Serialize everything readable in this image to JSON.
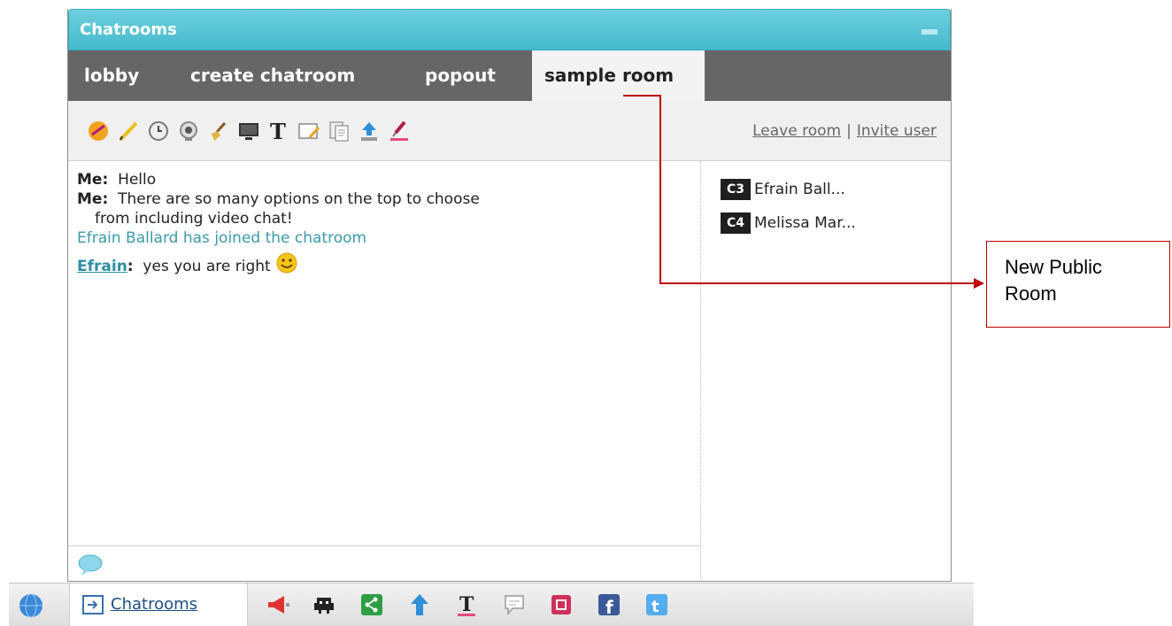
{
  "window": {
    "title": "Chatrooms"
  },
  "tabs": [
    {
      "label": "lobby"
    },
    {
      "label": "create chatroom"
    },
    {
      "label": "popout"
    },
    {
      "label": "sample room"
    }
  ],
  "toolbar": {
    "tools": [
      "ball-icon",
      "pencil-icon",
      "clock-icon",
      "webcam-icon",
      "broom-icon",
      "screen-icon",
      "text-icon",
      "whiteboard-icon",
      "document-icon",
      "upload-icon",
      "color-picker-icon"
    ],
    "leave_label": "Leave room",
    "separator": "|",
    "invite_label": "Invite user"
  },
  "messages": [
    {
      "sender": "Me:",
      "text": "Hello"
    },
    {
      "sender": "Me:",
      "text": "There are so many options on the top to choose",
      "cont": "from including video chat!"
    },
    {
      "system": "Efrain Ballard has joined the chatroom"
    },
    {
      "sender": "Efrain",
      "colon": ":",
      "text": "yes you are right"
    }
  ],
  "users": [
    {
      "badge": "C3",
      "name": "Efrain Ball..."
    },
    {
      "badge": "C4",
      "name": "Melissa Mar..."
    }
  ],
  "taskbar": {
    "chat_label": "Chatrooms"
  },
  "callout": {
    "line1": "New Public",
    "line2": "Room"
  },
  "colors": {
    "accent": "#45b9cc",
    "tabbar": "#666666",
    "annotation": "#c00000"
  }
}
